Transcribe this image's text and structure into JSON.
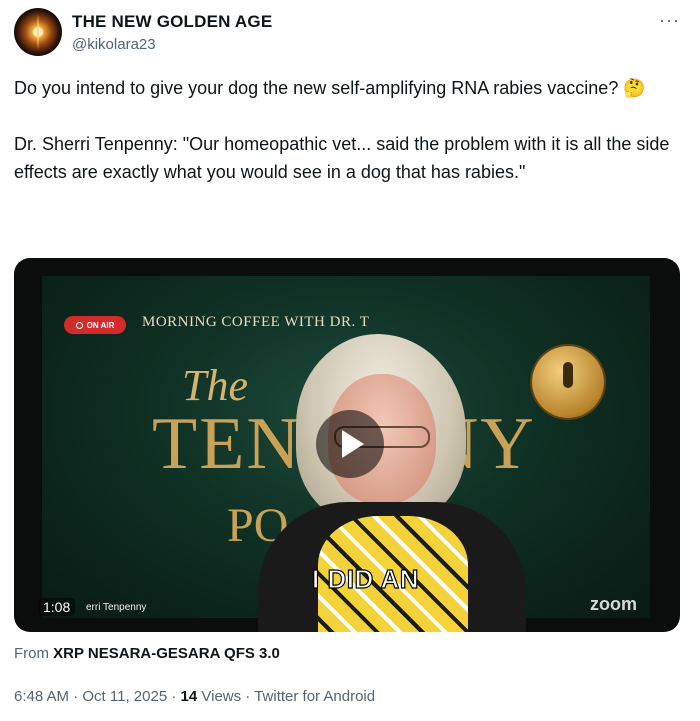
{
  "author": {
    "name": "THE NEW GOLDEN AGE",
    "handle": "@kikolara23"
  },
  "more_menu": "···",
  "tweet": {
    "line1": "Do you intend to give your dog the new self-amplifying RNA rabies vaccine?",
    "emoji": "🤔",
    "paragraph2": "Dr. Sherri Tenpenny: \"Our homeopathic vet... said the problem with it is all the side effects are exactly what you would see in a dog that has rabies.\""
  },
  "video": {
    "badge": "ON AIR",
    "show_title": "MORNING COFFEE WITH DR. T",
    "logo_the": "The",
    "logo_main": "TEN      NY",
    "logo_sub": "PO",
    "caption": "I DID AN",
    "zoom_label": "zoom",
    "duration": "1:08",
    "lower_third": "erri Tenpenny"
  },
  "source": {
    "prefix": "From",
    "name": "XRP NESARA-GESARA QFS 3.0"
  },
  "meta": {
    "time": "6:48 AM",
    "date": "Oct 11, 2025",
    "views_count": "14",
    "views_label": "Views",
    "client": "Twitter for Android",
    "sep": "·"
  }
}
